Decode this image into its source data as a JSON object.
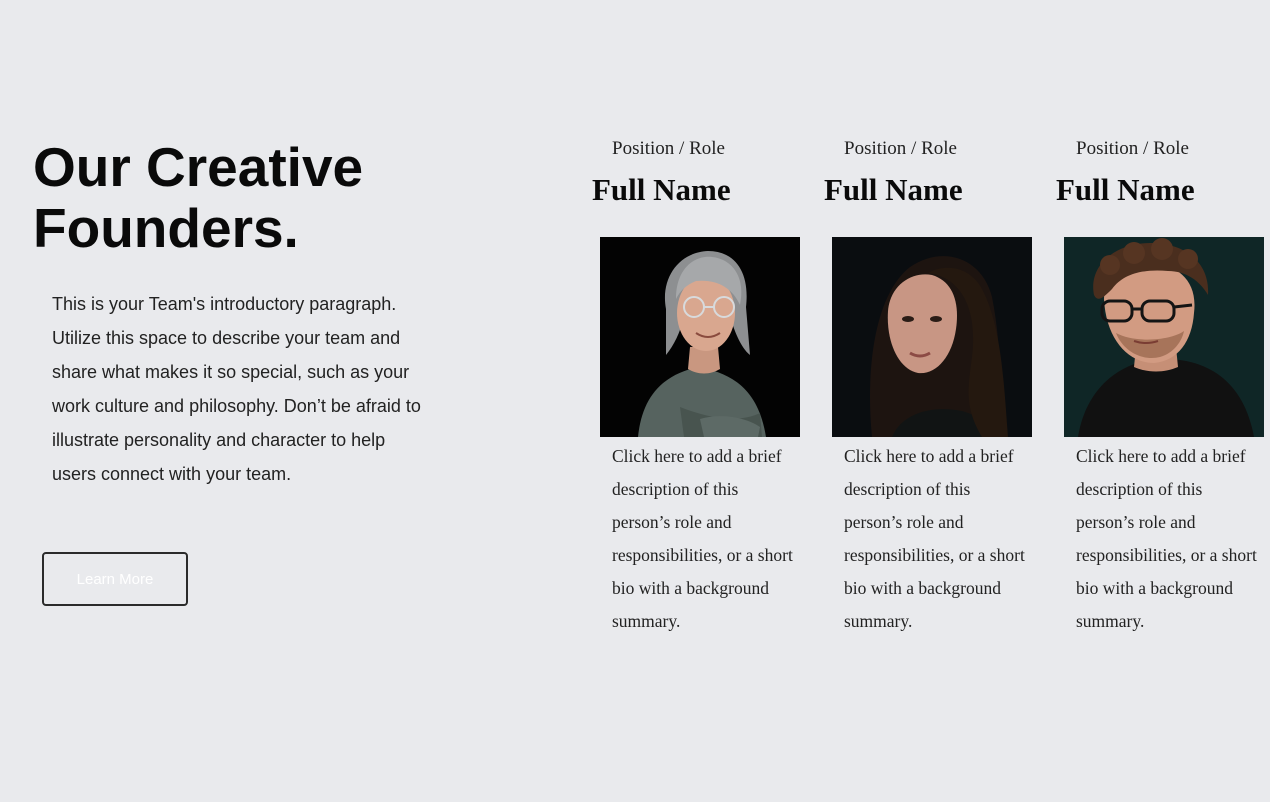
{
  "hero": {
    "heading": "Our Creative Founders.",
    "intro": "This is your Team's introductory paragraph. Utilize this space to describe your team and share what makes it so special, such as your work culture and philosophy. Don’t be afraid to illustrate personality and character to help users connect with your team.",
    "button_label": "Learn More"
  },
  "team": {
    "members": [
      {
        "role": "Position / Role",
        "name": "Full Name",
        "description": "Click here to add a brief description of this person’s role and responsibilities, or a short bio with a background summary."
      },
      {
        "role": "Position / Role",
        "name": "Full Name",
        "description": "Click here to add a brief description of this person’s role and responsibilities, or a short bio with a background summary."
      },
      {
        "role": "Position / Role",
        "name": "Full Name",
        "description": "Click here to add a brief description of this person’s role and responsibilities, or a short bio with a background summary."
      }
    ]
  },
  "colors": {
    "page_background": "#e9eaed",
    "heading_text": "#0a0a0a",
    "button_border": "#2b2b2b",
    "button_text": "#ffffff"
  }
}
